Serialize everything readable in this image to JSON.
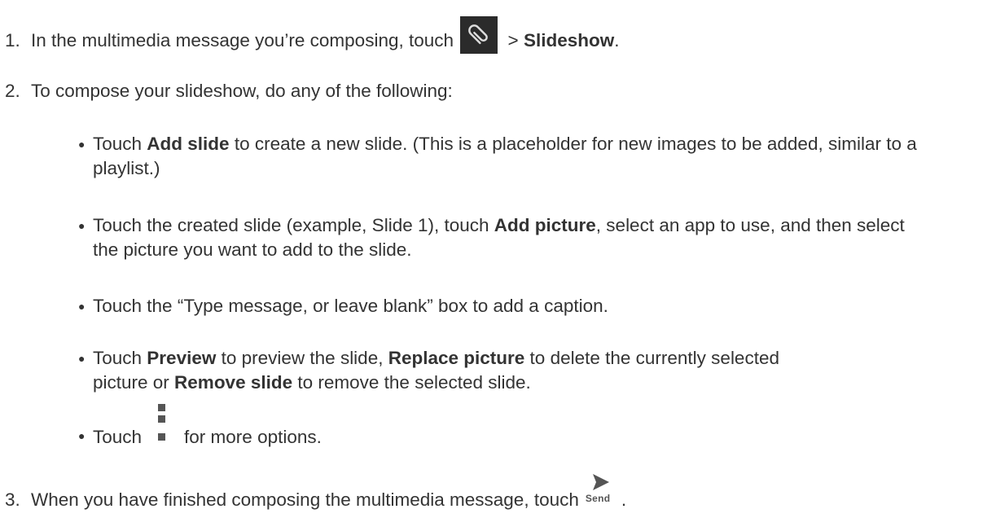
{
  "steps": [
    {
      "number": "1.",
      "before_icon": "In the multimedia message you’re composing, touch",
      "icon": "paperclip-icon",
      "after_icon": " > ",
      "bold": "Slideshow",
      "end": "."
    },
    {
      "number": "2.",
      "text": "To compose your slideshow, do any of the following:"
    },
    {
      "number": "3.",
      "before_icon": "When you have finished composing the multimedia message, touch",
      "icon": "send-icon",
      "icon_label": "Send",
      "end": "."
    }
  ],
  "bullets": [
    {
      "pre": "Touch ",
      "b1": "Add slide",
      "post": " to create a new slide. (This is a placeholder for new images to be added, similar to a playlist.)"
    },
    {
      "pre": "Touch the created slide (example, Slide 1), touch ",
      "b1": "Add picture",
      "post": ", select an app to use, and then select the picture you want to add to the slide."
    },
    {
      "text": "Touch the “Type message, or leave blank” box to add a caption."
    },
    {
      "pre": "Touch ",
      "b1": "Preview",
      "mid1": " to preview the slide, ",
      "b2": "Replace picture",
      "mid2": " to delete the currently selected picture or ",
      "b3": "Remove slide",
      "post": " to remove the selected slide."
    },
    {
      "pre": "Touch",
      "icon": "more-options-icon",
      "post": "for more options."
    }
  ],
  "bullet_char": "●"
}
